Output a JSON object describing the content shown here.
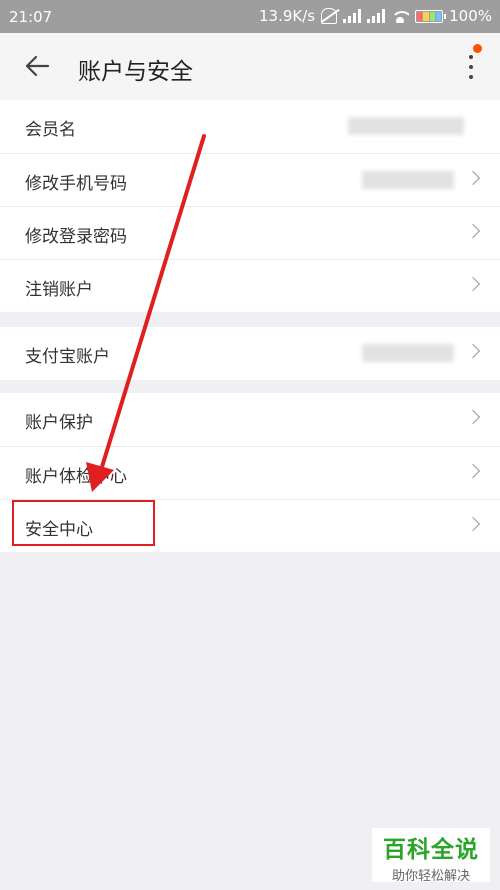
{
  "status_bar": {
    "time": "21:07",
    "speed": "13.9K/s",
    "battery": "100%"
  },
  "header": {
    "title": "账户与安全"
  },
  "groups": [
    {
      "items": [
        {
          "label": "会员名"
        },
        {
          "label": "修改手机号码"
        },
        {
          "label": "修改登录密码"
        },
        {
          "label": "注销账户"
        }
      ]
    },
    {
      "items": [
        {
          "label": "支付宝账户"
        }
      ]
    },
    {
      "items": [
        {
          "label": "账户保护"
        },
        {
          "label": "账户体检中心"
        },
        {
          "label": "安全中心"
        }
      ]
    }
  ],
  "watermark": {
    "title": "百科全说",
    "subtitle": "助你轻松解决"
  },
  "colors": {
    "status_bar": "#9e9e9e",
    "page_bg": "#efeff4",
    "annotation_red": "#e02020",
    "notification_dot": "#ff5000",
    "watermark_green": "#2aa52a"
  }
}
